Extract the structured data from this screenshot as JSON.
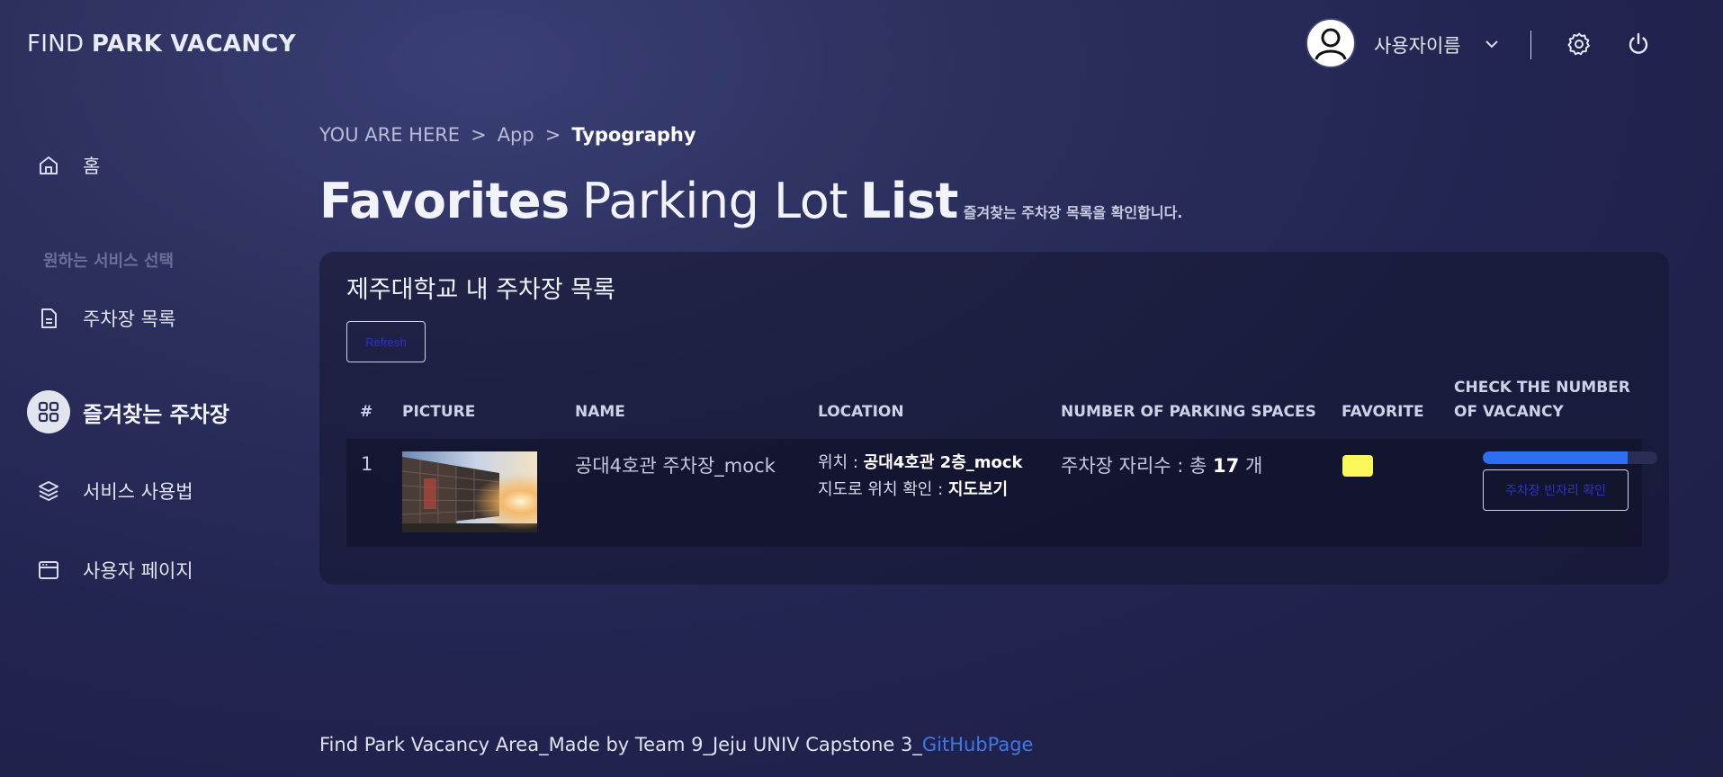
{
  "brand": {
    "prefix": "FIND ",
    "emphasis": "PARK VACANCY"
  },
  "header": {
    "username": "사용자이름",
    "icons": {
      "avatar": "user-avatar-icon",
      "dropdown": "chevron-down-icon",
      "settings": "settings-gear-icon",
      "logout": "power-icon"
    }
  },
  "sidebar": {
    "section_label": "원하는 서비스 선택",
    "items": [
      {
        "label": "홈",
        "icon": "home-icon",
        "active": false
      },
      {
        "label": "주차장 목록",
        "icon": "document-icon",
        "active": false
      },
      {
        "label": "즐겨찾는 주차장",
        "icon": "grid-icon",
        "active": true
      },
      {
        "label": "서비스 사용법",
        "icon": "layers-icon",
        "active": false
      },
      {
        "label": "사용자 페이지",
        "icon": "browser-window-icon",
        "active": false
      }
    ]
  },
  "breadcrumb": {
    "prefix": "YOU ARE HERE",
    "items": [
      "App",
      "Typography"
    ],
    "separator": ">"
  },
  "page_title": {
    "part1": "Favorites",
    "part2": "Parking Lot",
    "part3": "List",
    "subtitle": "즐겨찾는 주차장 목록을 확인합니다."
  },
  "card": {
    "title": "제주대학교 내 주차장 목록",
    "refresh_label": "Refresh",
    "columns": {
      "index": "#",
      "picture": "PICTURE",
      "name": "NAME",
      "location": "LOCATION",
      "spaces": "NUMBER OF PARKING SPACES",
      "favorite": "FAVORITE",
      "vacancy_line1": "CHECK THE NUMBER",
      "vacancy_line2": "OF VACANCY"
    },
    "rows": [
      {
        "index": "1",
        "name": "공대4호관 주차장_mock",
        "location_label": "위치 : ",
        "location_value": "공대4호관 2층_mock",
        "map_label": "지도로 위치 확인 : ",
        "map_link": "지도보기",
        "spaces_prefix": "주차장 자리수 : 총 ",
        "spaces_count": "17",
        "spaces_suffix": " 개",
        "favorite_color": "#f8f85a",
        "vacancy_progress": 0.83,
        "check_button_label": "주차장 빈자리 확인"
      }
    ]
  },
  "footer": {
    "text": "Find Park Vacancy Area_Made by Team 9_Jeju UNIV Capstone 3_",
    "link": "GitHubPage"
  },
  "colors": {
    "background": "#262a56",
    "accent_blue": "#2d6ff2",
    "link_blue": "#3f78e6",
    "favorite_yellow": "#f8f85a"
  }
}
